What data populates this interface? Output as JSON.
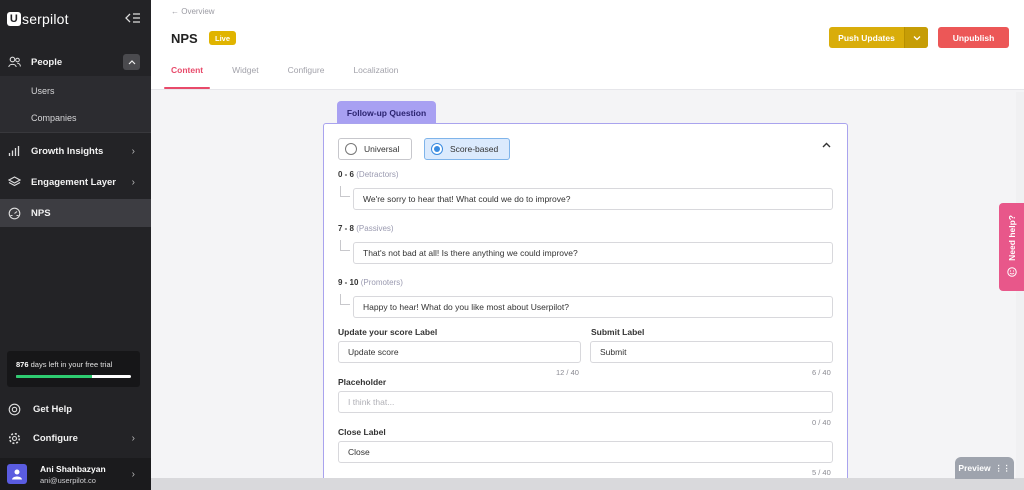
{
  "sidebar": {
    "logo_text": "serpilot",
    "logo_letter": "U",
    "collapse_icon": "collapse-sidebar-icon",
    "people": {
      "label": "People",
      "sub_items": [
        {
          "label": "Users"
        },
        {
          "label": "Companies"
        }
      ]
    },
    "items": [
      {
        "label": "Growth Insights",
        "icon": "bar-chart-icon"
      },
      {
        "label": "Engagement Layer",
        "icon": "layers-icon"
      },
      {
        "label": "NPS",
        "icon": "gauge-icon"
      }
    ],
    "trial": {
      "days": "876",
      "suffix": "days left in your free trial",
      "progress": 0.66
    },
    "get_help": "Get Help",
    "configure": "Configure",
    "user": {
      "name": "Ani Shahbazyan",
      "email": "ani@userpilot.co"
    }
  },
  "header": {
    "back_label": "← Overview",
    "title": "NPS",
    "badge": "Live",
    "push_updates": "Push Updates",
    "unpublish": "Unpublish",
    "tabs": [
      {
        "label": "Content",
        "active": true
      },
      {
        "label": "Widget"
      },
      {
        "label": "Configure"
      },
      {
        "label": "Localization"
      }
    ]
  },
  "card": {
    "tab_label": "Follow-up Question",
    "universal": "Universal",
    "score_based": "Score-based",
    "groups": [
      {
        "range": "0 - 6",
        "name": "(Detractors)",
        "text": "We're sorry to hear that! What could we do to improve?"
      },
      {
        "range": "7 - 8",
        "name": "(Passives)",
        "text": "That's not bad at all! Is there anything we could improve?"
      },
      {
        "range": "9 - 10",
        "name": "(Promoters)",
        "text": "Happy to hear! What do you like most about Userpilot?"
      }
    ],
    "update_label": {
      "label": "Update your score Label",
      "value": "Update score",
      "counter": "12 / 40"
    },
    "submit_label": {
      "label": "Submit Label",
      "value": "Submit",
      "counter": "6 / 40"
    },
    "placeholder": {
      "label": "Placeholder",
      "placeholder": "I think that...",
      "counter": "0 / 40"
    },
    "close_label": {
      "label": "Close Label",
      "value": "Close",
      "counter": "5 / 40"
    }
  },
  "widgets": {
    "need_help": "Need help?",
    "preview": "Preview"
  },
  "colors": {
    "sidebar_bg": "#232326",
    "accent_pink": "#e84a6a",
    "push_yellow": "#d9ad0a",
    "unpublish_red": "#ec5757",
    "card_purple": "#a8a0f2"
  }
}
